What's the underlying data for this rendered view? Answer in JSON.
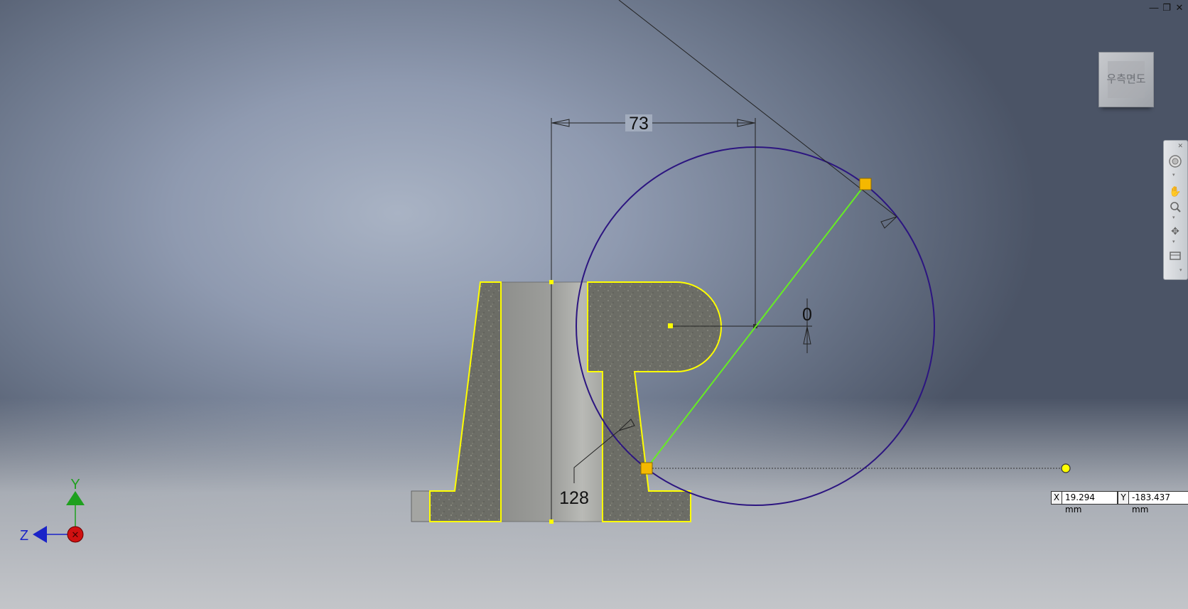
{
  "window_controls": {
    "minimize": "—",
    "restore": "❐",
    "close": "✕"
  },
  "viewcube": {
    "label": "우측면도"
  },
  "dimensions": {
    "horizontal": "73",
    "vertical": "0",
    "diameter": "128"
  },
  "coordinates": {
    "x_label": "X",
    "x_value": "19.294 mm",
    "y_label": "Y",
    "y_value": "-183.437 mm"
  },
  "axis_triad": {
    "y_label": "Y",
    "z_label": "Z"
  },
  "navigation_bar": {
    "tools": [
      "steering-wheel-icon",
      "pan-hand-icon",
      "zoom-icon",
      "orbit-icon",
      "view-face-icon"
    ]
  },
  "colors": {
    "circle": "#2c1580",
    "selection_edge": "#ffff00",
    "constraint_line": "#66ee22",
    "grip_point": "#f5b800",
    "axis_y": "#1fa01f",
    "axis_z": "#1a23c8",
    "axis_x": "#d01010"
  }
}
